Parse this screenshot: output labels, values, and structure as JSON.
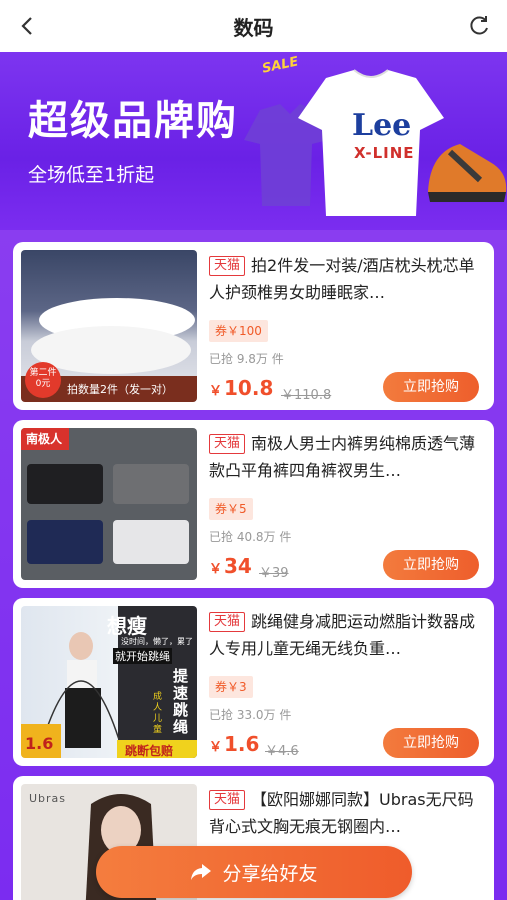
{
  "header": {
    "title": "数码",
    "back_icon": "chevron-left-icon",
    "refresh_icon": "refresh-icon"
  },
  "banner": {
    "headline": "超级品牌购",
    "subline": "全场低至1折起",
    "sale_tag": "SALE",
    "brand_name": "Lee",
    "brand_line": "X-LINE"
  },
  "products": [
    {
      "store": "天猫",
      "name": "拍2件发一对装/酒店枕头枕芯单人护颈椎男女助睡眠家…",
      "coupon": "券￥100",
      "sold": "已抢 9.8万 件",
      "price_symbol": "￥",
      "price": "10.8",
      "original_price": "￥110.8",
      "buy_label": "立即抢购",
      "img_badge": "第二件 0元",
      "img_caption": "拍数量2件（发一对）"
    },
    {
      "store": "天猫",
      "name": "南极人男士内裤男纯棉质透气薄款凸平角裤四角裤衩男生…",
      "coupon": "券￥5",
      "sold": "已抢 40.8万 件",
      "price_symbol": "￥",
      "price": "34",
      "original_price": "￥39",
      "buy_label": "立即抢购",
      "img_brand": "南极人"
    },
    {
      "store": "天猫",
      "name": "跳绳健身减肥运动燃脂计数器成人专用儿童无绳无线负重…",
      "coupon": "券￥3",
      "sold": "已抢 33.0万 件",
      "price_symbol": "￥",
      "price": "1.6",
      "original_price": "￥4.6",
      "buy_label": "立即抢购",
      "img_headline": "想瘦",
      "img_sub": "没时间，懒了，累了",
      "img_start": "就开始跳绳",
      "img_side": "提速跳绳",
      "img_side2": "成人 儿童",
      "img_price": "1.6",
      "img_bottom": "跳断包赔"
    },
    {
      "store": "天猫",
      "name": "【欧阳娜娜同款】Ubras无尺码背心式文胸无痕无钢圈内…",
      "img_brand": "Ubras"
    }
  ],
  "share_button": {
    "label": "分享给好友",
    "icon": "share-arrow-icon"
  },
  "colors": {
    "accent": "#ef5c2b",
    "banner": "#7a2ff0",
    "tmall_red": "#e4393c"
  }
}
